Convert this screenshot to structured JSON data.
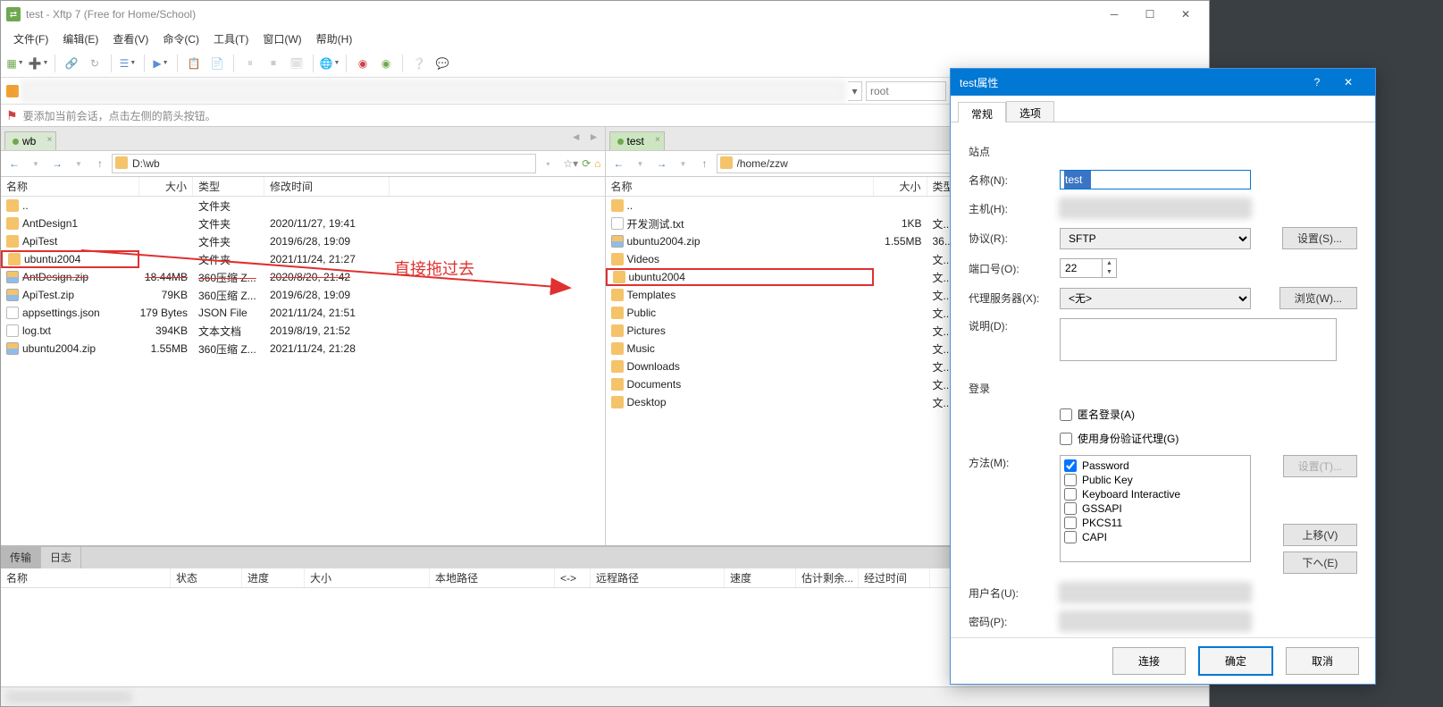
{
  "window": {
    "title": "test - Xftp 7 (Free for Home/School)"
  },
  "menu": {
    "items": [
      "文件(F)",
      "编辑(E)",
      "查看(V)",
      "命令(C)",
      "工具(T)",
      "窗口(W)",
      "帮助(H)"
    ]
  },
  "address": {
    "user": "root",
    "hint": "要添加当前会话，点击左侧的箭头按钮。"
  },
  "left": {
    "tab": "wb",
    "path": "D:\\wb",
    "headers": {
      "name": "名称",
      "size": "大小",
      "type": "类型",
      "modified": "修改时间"
    },
    "rows": [
      {
        "name": "..",
        "size": "",
        "type": "文件夹",
        "modified": "",
        "ico": "folder"
      },
      {
        "name": "AntDesign1",
        "size": "",
        "type": "文件夹",
        "modified": "2020/11/27, 19:41",
        "ico": "folder"
      },
      {
        "name": "ApiTest",
        "size": "",
        "type": "文件夹",
        "modified": "2019/6/28, 19:09",
        "ico": "folder"
      },
      {
        "name": "ubuntu2004",
        "size": "",
        "type": "文件夹",
        "modified": "2021/11/24, 21:27",
        "ico": "folder",
        "boxed": true
      },
      {
        "name": "AntDesign.zip",
        "size": "18.44MB",
        "type": "360压缩 Z...",
        "modified": "2020/8/20, 21:42",
        "ico": "zip",
        "strike": true
      },
      {
        "name": "ApiTest.zip",
        "size": "79KB",
        "type": "360压缩 Z...",
        "modified": "2019/6/28, 19:09",
        "ico": "zip"
      },
      {
        "name": "appsettings.json",
        "size": "179 Bytes",
        "type": "JSON File",
        "modified": "2021/11/24, 21:51",
        "ico": "file"
      },
      {
        "name": "log.txt",
        "size": "394KB",
        "type": "文本文档",
        "modified": "2019/8/19, 21:52",
        "ico": "txt"
      },
      {
        "name": "ubuntu2004.zip",
        "size": "1.55MB",
        "type": "360压缩 Z...",
        "modified": "2021/11/24, 21:28",
        "ico": "zip"
      }
    ]
  },
  "right": {
    "tab": "test",
    "path": "/home/zzw",
    "headers": {
      "name": "名称",
      "size": "大小",
      "type": "类型"
    },
    "rows": [
      {
        "name": "..",
        "size": "",
        "type": "",
        "ico": "folder"
      },
      {
        "name": "开发测试.txt",
        "size": "1KB",
        "type": "文...",
        "ico": "txt"
      },
      {
        "name": "ubuntu2004.zip",
        "size": "1.55MB",
        "type": "36...",
        "ico": "zip"
      },
      {
        "name": "Videos",
        "size": "",
        "type": "文...",
        "ico": "folder"
      },
      {
        "name": "ubuntu2004",
        "size": "",
        "type": "文...",
        "ico": "folder",
        "boxed": true
      },
      {
        "name": "Templates",
        "size": "",
        "type": "文...",
        "ico": "folder"
      },
      {
        "name": "Public",
        "size": "",
        "type": "文...",
        "ico": "folder"
      },
      {
        "name": "Pictures",
        "size": "",
        "type": "文...",
        "ico": "folder"
      },
      {
        "name": "Music",
        "size": "",
        "type": "文...",
        "ico": "folder"
      },
      {
        "name": "Downloads",
        "size": "",
        "type": "文...",
        "ico": "folder"
      },
      {
        "name": "Documents",
        "size": "",
        "type": "文...",
        "ico": "folder"
      },
      {
        "name": "Desktop",
        "size": "",
        "type": "文...",
        "ico": "folder"
      }
    ]
  },
  "annotation": {
    "text": "直接拖过去"
  },
  "transfer": {
    "tabs": {
      "transfer": "传输",
      "log": "日志"
    },
    "headers": {
      "name": "名称",
      "status": "状态",
      "progress": "进度",
      "size": "大小",
      "local": "本地路径",
      "arrow": "<->",
      "remote": "远程路径",
      "speed": "速度",
      "remain": "估计剩余...",
      "elapsed": "经过时间"
    }
  },
  "dialog": {
    "title": "test属性",
    "tabs": {
      "general": "常规",
      "options": "选项"
    },
    "section_site": "站点",
    "lbl_name": "名称(N):",
    "val_name": "test",
    "lbl_host": "主机(H):",
    "val_host": "",
    "lbl_proto": "协议(R):",
    "val_proto": "SFTP",
    "btn_setup": "设置(S)...",
    "lbl_port": "端口号(O):",
    "val_port": "22",
    "lbl_proxy": "代理服务器(X):",
    "val_proxy": "<无>",
    "btn_browse": "浏览(W)...",
    "lbl_desc": "说明(D):",
    "section_login": "登录",
    "chk_anon": "匿名登录(A)",
    "chk_agent": "使用身份验证代理(G)",
    "lbl_method": "方法(M):",
    "methods": [
      "Password",
      "Public Key",
      "Keyboard Interactive",
      "GSSAPI",
      "PKCS11",
      "CAPI"
    ],
    "btn_method_setup": "设置(T)...",
    "btn_up": "上移(V)",
    "btn_down": "下へ(E)",
    "lbl_user": "用户名(U):",
    "lbl_pass": "密码(P):",
    "btn_connect": "连接",
    "btn_ok": "确定",
    "btn_cancel": "取消"
  }
}
